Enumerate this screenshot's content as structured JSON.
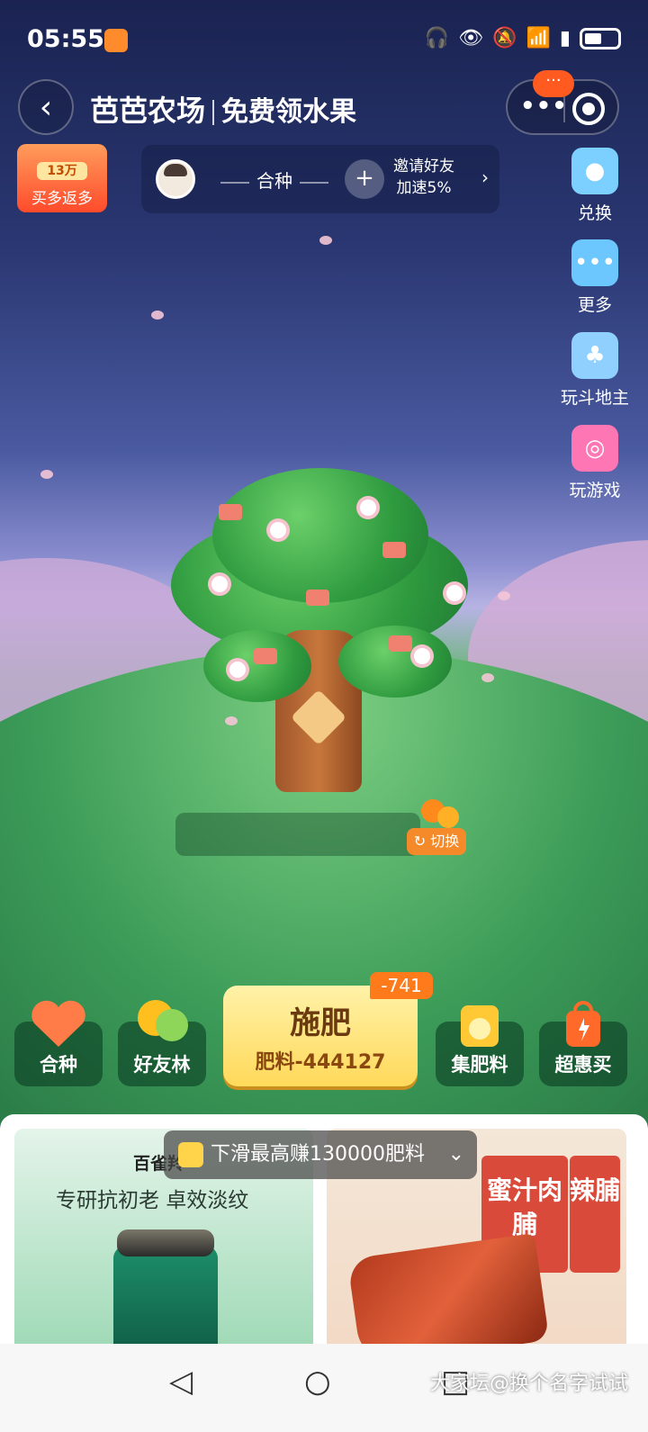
{
  "status_bar": {
    "time": "05:55",
    "icons": [
      "headphones-icon",
      "eye-icon",
      "mute-icon",
      "wifi-icon",
      "signal-5g-icon",
      "battery-icon"
    ]
  },
  "header": {
    "title": "芭芭农场",
    "subtitle": "免费领水果",
    "notification": "···"
  },
  "promo": {
    "amount": "13万",
    "label": "买多返多"
  },
  "friend_bar": {
    "cotree_label": "合种",
    "invite_line1": "邀请好友",
    "invite_line2": "加速5%"
  },
  "side_menu": [
    {
      "label": "兑换",
      "icon": "exchange-icon",
      "color": "#5bb8f0"
    },
    {
      "label": "更多",
      "icon": "more-icon",
      "color": "#4ba8e8"
    },
    {
      "label": "玩斗地主",
      "icon": "club-icon",
      "color": "#3a8be0"
    },
    {
      "label": "玩游戏",
      "icon": "gamepad-icon",
      "color": "#ff5aa5"
    }
  ],
  "tree": {
    "switch_label": "切换"
  },
  "actions": {
    "cotree": "合种",
    "friend_forest": "好友林",
    "fertilize": "施肥",
    "fertilizer_count": "肥料-444127",
    "badge": "-741",
    "collect": "集肥料",
    "deals": "超惠买"
  },
  "feed": {
    "scroll_tip": "下滑最高赚130000肥料",
    "left_card": {
      "brand": "百雀羚",
      "slogan": "专研抗初老 卓效淡纹"
    },
    "right_card": {
      "pack1": "蜜汁肉脯",
      "pack2": "辣脯"
    }
  },
  "navbar": {
    "watermark": "大家坛@换个名字试试"
  }
}
